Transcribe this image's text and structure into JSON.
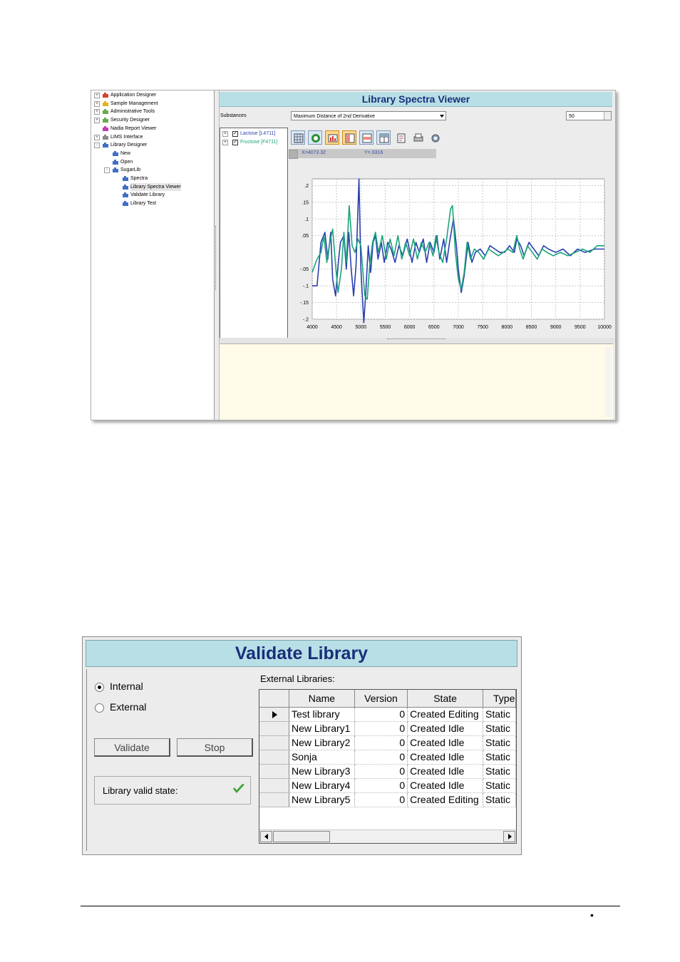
{
  "tree": {
    "items": [
      {
        "label": "Application Designer",
        "level": 0,
        "expander": "+",
        "icon": "red-puzzle-icon"
      },
      {
        "label": "Sample Management",
        "level": 0,
        "expander": "+",
        "icon": "yellow-puzzle-icon"
      },
      {
        "label": "Administrative Tools",
        "level": 0,
        "expander": "+",
        "icon": "green-puzzle-icon"
      },
      {
        "label": "Security Designer",
        "level": 0,
        "expander": "+",
        "icon": "green-puzzle-icon"
      },
      {
        "label": "Nadia Report Viewer",
        "level": 0,
        "expander": "",
        "icon": "pink-puzzle-icon"
      },
      {
        "label": "LIMS Interface",
        "level": 0,
        "expander": "+",
        "icon": "gray-puzzle-icon"
      },
      {
        "label": "Library Designer",
        "level": 0,
        "expander": "-",
        "icon": "blue-puzzle-icon"
      },
      {
        "label": "New",
        "level": 1,
        "expander": "",
        "icon": "blue-puzzle-icon"
      },
      {
        "label": "Open",
        "level": 1,
        "expander": "",
        "icon": "blue-puzzle-icon"
      },
      {
        "label": "SugarLib",
        "level": 1,
        "expander": "-",
        "icon": "blue-puzzle-icon"
      },
      {
        "label": "Spectra",
        "level": 2,
        "expander": "",
        "icon": "blue-puzzle-icon"
      },
      {
        "label": "Library Spectra Viewer",
        "level": 2,
        "expander": "",
        "icon": "blue-puzzle-icon",
        "selected": true
      },
      {
        "label": "Validate Library",
        "level": 2,
        "expander": "",
        "icon": "blue-puzzle-icon"
      },
      {
        "label": "Library Test",
        "level": 2,
        "expander": "",
        "icon": "blue-puzzle-icon"
      }
    ]
  },
  "viewer": {
    "title": "Library Spectra Viewer",
    "substances_label": "Substances",
    "metric_selected": "Maximum Distance of 2nd Derivative",
    "value": "50",
    "substances": [
      {
        "label": "Lactose [L4711]",
        "checked": true,
        "color": "#2a3fb0"
      },
      {
        "label": "Fructose [F4711]",
        "checked": true,
        "color": "#1aa37a"
      }
    ],
    "toolbar_icons": [
      "grid-icon",
      "globe-icon",
      "bar-chart-icon",
      "columns-icon",
      "rows-icon",
      "table-icon",
      "export-icon",
      "print-icon",
      "settings-icon"
    ],
    "coords": {
      "x": "X=4073.32",
      "y": "Y=.0316"
    }
  },
  "chart_data": {
    "type": "line",
    "xlim": [
      4000,
      10000
    ],
    "ylim": [
      -0.2,
      0.22
    ],
    "x_ticks": [
      "4000",
      "4500",
      "5000",
      "5500",
      "6000",
      "6500",
      "7000",
      "7500",
      "8000",
      "8500",
      "9000",
      "9500",
      "10000"
    ],
    "y_ticks": [
      {
        "v": 0.2,
        "label": ".2"
      },
      {
        "v": 0.15,
        "label": ".15"
      },
      {
        "v": 0.1,
        "label": ".1"
      },
      {
        "v": 0.05,
        "label": ".05"
      },
      {
        "v": -0.05,
        "label": "-.05"
      },
      {
        "v": -0.1,
        "label": "-.1"
      },
      {
        "v": -0.15,
        "label": "-.15"
      },
      {
        "v": -0.2,
        "label": "-.2"
      }
    ],
    "grid": true,
    "series": [
      {
        "name": "Lactose [L4711]",
        "color": "#2a3fb0",
        "points": [
          [
            4000,
            -0.1
          ],
          [
            4100,
            -0.1
          ],
          [
            4180,
            0.03
          ],
          [
            4260,
            0.06
          ],
          [
            4320,
            -0.02
          ],
          [
            4380,
            0.06
          ],
          [
            4420,
            -0.08
          ],
          [
            4480,
            -0.13
          ],
          [
            4530,
            -0.04
          ],
          [
            4580,
            0.03
          ],
          [
            4650,
            0.05
          ],
          [
            4700,
            -0.05
          ],
          [
            4750,
            0.06
          ],
          [
            4800,
            -0.05
          ],
          [
            4850,
            -0.13
          ],
          [
            4900,
            -0.04
          ],
          [
            4960,
            0.22
          ],
          [
            5000,
            -0.05
          ],
          [
            5060,
            -0.21
          ],
          [
            5100,
            -0.12
          ],
          [
            5150,
            0.02
          ],
          [
            5200,
            -0.06
          ],
          [
            5250,
            0.03
          ],
          [
            5300,
            0.05
          ],
          [
            5350,
            -0.02
          ],
          [
            5420,
            0.03
          ],
          [
            5480,
            -0.03
          ],
          [
            5550,
            0.03
          ],
          [
            5620,
            0.01
          ],
          [
            5700,
            -0.03
          ],
          [
            5780,
            0.02
          ],
          [
            5860,
            -0.01
          ],
          [
            5950,
            0.04
          ],
          [
            6050,
            -0.03
          ],
          [
            6130,
            0.03
          ],
          [
            6200,
            0.0
          ],
          [
            6280,
            0.04
          ],
          [
            6350,
            -0.03
          ],
          [
            6420,
            0.03
          ],
          [
            6500,
            0.0
          ],
          [
            6560,
            0.05
          ],
          [
            6620,
            -0.02
          ],
          [
            6700,
            0.04
          ],
          [
            6760,
            -0.03
          ],
          [
            6820,
            0.03
          ],
          [
            6900,
            0.1
          ],
          [
            6960,
            0.02
          ],
          [
            7000,
            -0.05
          ],
          [
            7060,
            -0.12
          ],
          [
            7120,
            -0.07
          ],
          [
            7200,
            0.03
          ],
          [
            7280,
            -0.03
          ],
          [
            7350,
            0.0
          ],
          [
            7450,
            0.01
          ],
          [
            7550,
            -0.01
          ],
          [
            7650,
            0.02
          ],
          [
            7750,
            0.01
          ],
          [
            7850,
            0.0
          ],
          [
            7950,
            0.0
          ],
          [
            8050,
            0.02
          ],
          [
            8150,
            0.0
          ],
          [
            8200,
            0.04
          ],
          [
            8280,
            0.02
          ],
          [
            8350,
            -0.01
          ],
          [
            8450,
            0.03
          ],
          [
            8550,
            0.01
          ],
          [
            8650,
            -0.01
          ],
          [
            8750,
            0.02
          ],
          [
            8850,
            0.01
          ],
          [
            9000,
            0.0
          ],
          [
            9150,
            0.01
          ],
          [
            9300,
            -0.01
          ],
          [
            9450,
            0.01
          ],
          [
            9600,
            0.0
          ],
          [
            9800,
            0.01
          ],
          [
            10000,
            0.01
          ]
        ]
      },
      {
        "name": "Fructose [F4711]",
        "color": "#1aa37a",
        "points": [
          [
            4000,
            -0.06
          ],
          [
            4100,
            -0.02
          ],
          [
            4180,
            0.0
          ],
          [
            4240,
            0.05
          ],
          [
            4300,
            -0.03
          ],
          [
            4360,
            0.03
          ],
          [
            4420,
            0.07
          ],
          [
            4470,
            -0.02
          ],
          [
            4530,
            -0.12
          ],
          [
            4600,
            -0.05
          ],
          [
            4650,
            0.06
          ],
          [
            4700,
            -0.03
          ],
          [
            4760,
            0.14
          ],
          [
            4820,
            0.02
          ],
          [
            4880,
            0.0
          ],
          [
            4940,
            0.04
          ],
          [
            5000,
            0.02
          ],
          [
            5080,
            -0.13
          ],
          [
            5130,
            -0.14
          ],
          [
            5180,
            -0.04
          ],
          [
            5240,
            0.03
          ],
          [
            5300,
            0.06
          ],
          [
            5360,
            0.0
          ],
          [
            5440,
            0.05
          ],
          [
            5520,
            -0.02
          ],
          [
            5600,
            0.04
          ],
          [
            5680,
            -0.01
          ],
          [
            5760,
            0.05
          ],
          [
            5840,
            -0.02
          ],
          [
            5920,
            0.03
          ],
          [
            6000,
            -0.01
          ],
          [
            6080,
            0.04
          ],
          [
            6160,
            -0.02
          ],
          [
            6240,
            0.03
          ],
          [
            6320,
            0.0
          ],
          [
            6400,
            0.03
          ],
          [
            6480,
            -0.01
          ],
          [
            6540,
            0.05
          ],
          [
            6600,
            0.0
          ],
          [
            6680,
            -0.03
          ],
          [
            6760,
            0.04
          ],
          [
            6840,
            0.13
          ],
          [
            6880,
            0.14
          ],
          [
            6940,
            0.0
          ],
          [
            7000,
            -0.08
          ],
          [
            7060,
            -0.11
          ],
          [
            7120,
            -0.06
          ],
          [
            7180,
            0.03
          ],
          [
            7250,
            -0.02
          ],
          [
            7330,
            0.01
          ],
          [
            7420,
            0.0
          ],
          [
            7520,
            -0.02
          ],
          [
            7620,
            0.01
          ],
          [
            7720,
            0.0
          ],
          [
            7820,
            -0.01
          ],
          [
            7920,
            0.0
          ],
          [
            8020,
            0.01
          ],
          [
            8120,
            0.0
          ],
          [
            8200,
            0.05
          ],
          [
            8260,
            0.01
          ],
          [
            8330,
            -0.02
          ],
          [
            8420,
            0.02
          ],
          [
            8520,
            0.0
          ],
          [
            8620,
            -0.02
          ],
          [
            8720,
            0.01
          ],
          [
            8820,
            0.0
          ],
          [
            8950,
            -0.01
          ],
          [
            9100,
            0.0
          ],
          [
            9250,
            -0.01
          ],
          [
            9400,
            0.0
          ],
          [
            9550,
            0.01
          ],
          [
            9700,
            0.0
          ],
          [
            9850,
            0.02
          ],
          [
            10000,
            0.02
          ]
        ]
      }
    ]
  },
  "validate": {
    "title": "Validate Library",
    "radio_internal": "Internal",
    "radio_external": "External",
    "internal_selected": true,
    "validate_button": "Validate",
    "stop_button": "Stop",
    "valid_state_label": "Library valid state:",
    "external_libraries_label": "External Libraries:",
    "columns": [
      "Name",
      "Version",
      "State",
      "Type"
    ],
    "rows": [
      {
        "name": "Test library",
        "version": "0",
        "state": "Created Editing",
        "type": "Static",
        "current": true
      },
      {
        "name": "New Library1",
        "version": "0",
        "state": "Created Idle",
        "type": "Static"
      },
      {
        "name": "New Library2",
        "version": "0",
        "state": "Created Idle",
        "type": "Static"
      },
      {
        "name": "Sonja",
        "version": "0",
        "state": "Created Idle",
        "type": "Static"
      },
      {
        "name": "New Library3",
        "version": "0",
        "state": "Created Idle",
        "type": "Static"
      },
      {
        "name": "New Library4",
        "version": "0",
        "state": "Created Idle",
        "type": "Static"
      },
      {
        "name": "New Library5",
        "version": "0",
        "state": "Created Editing",
        "type": "Static"
      }
    ]
  },
  "footer": {
    "bullet": "•"
  },
  "colors": {
    "title_bg": "#b9dfe6",
    "title_text": "#1a2e7a",
    "check": "#3aa635",
    "notes_bg": "#fffbe8"
  }
}
